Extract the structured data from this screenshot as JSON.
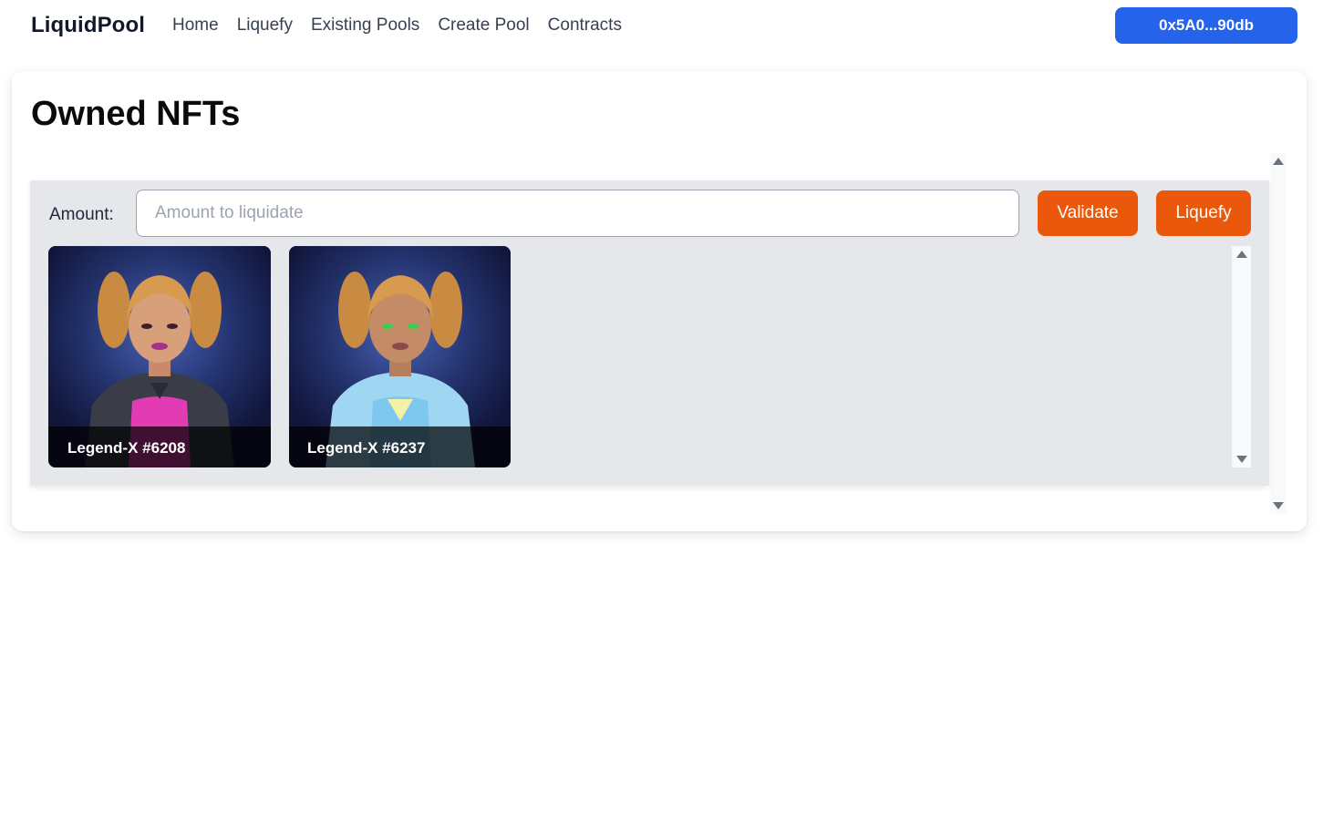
{
  "navbar": {
    "brand": "LiquidPool",
    "links": [
      "Home",
      "Liquefy",
      "Existing Pools",
      "Create Pool",
      "Contracts"
    ],
    "wallet_address": "0x5A0...90db"
  },
  "main": {
    "title": "Owned NFTs",
    "amount_label": "Amount:",
    "amount_placeholder": "Amount to liquidate",
    "amount_value": "",
    "validate_label": "Validate",
    "liquefy_label": "Liquefy",
    "nfts": [
      {
        "name": "Legend-X #6208",
        "suit_color": "#e23cb5"
      },
      {
        "name": "Legend-X #6237",
        "suit_color": "#7ec8f0"
      }
    ]
  },
  "colors": {
    "accent_blue": "#2563eb",
    "accent_orange": "#ea580c",
    "panel_gray": "#e5e7eb"
  }
}
